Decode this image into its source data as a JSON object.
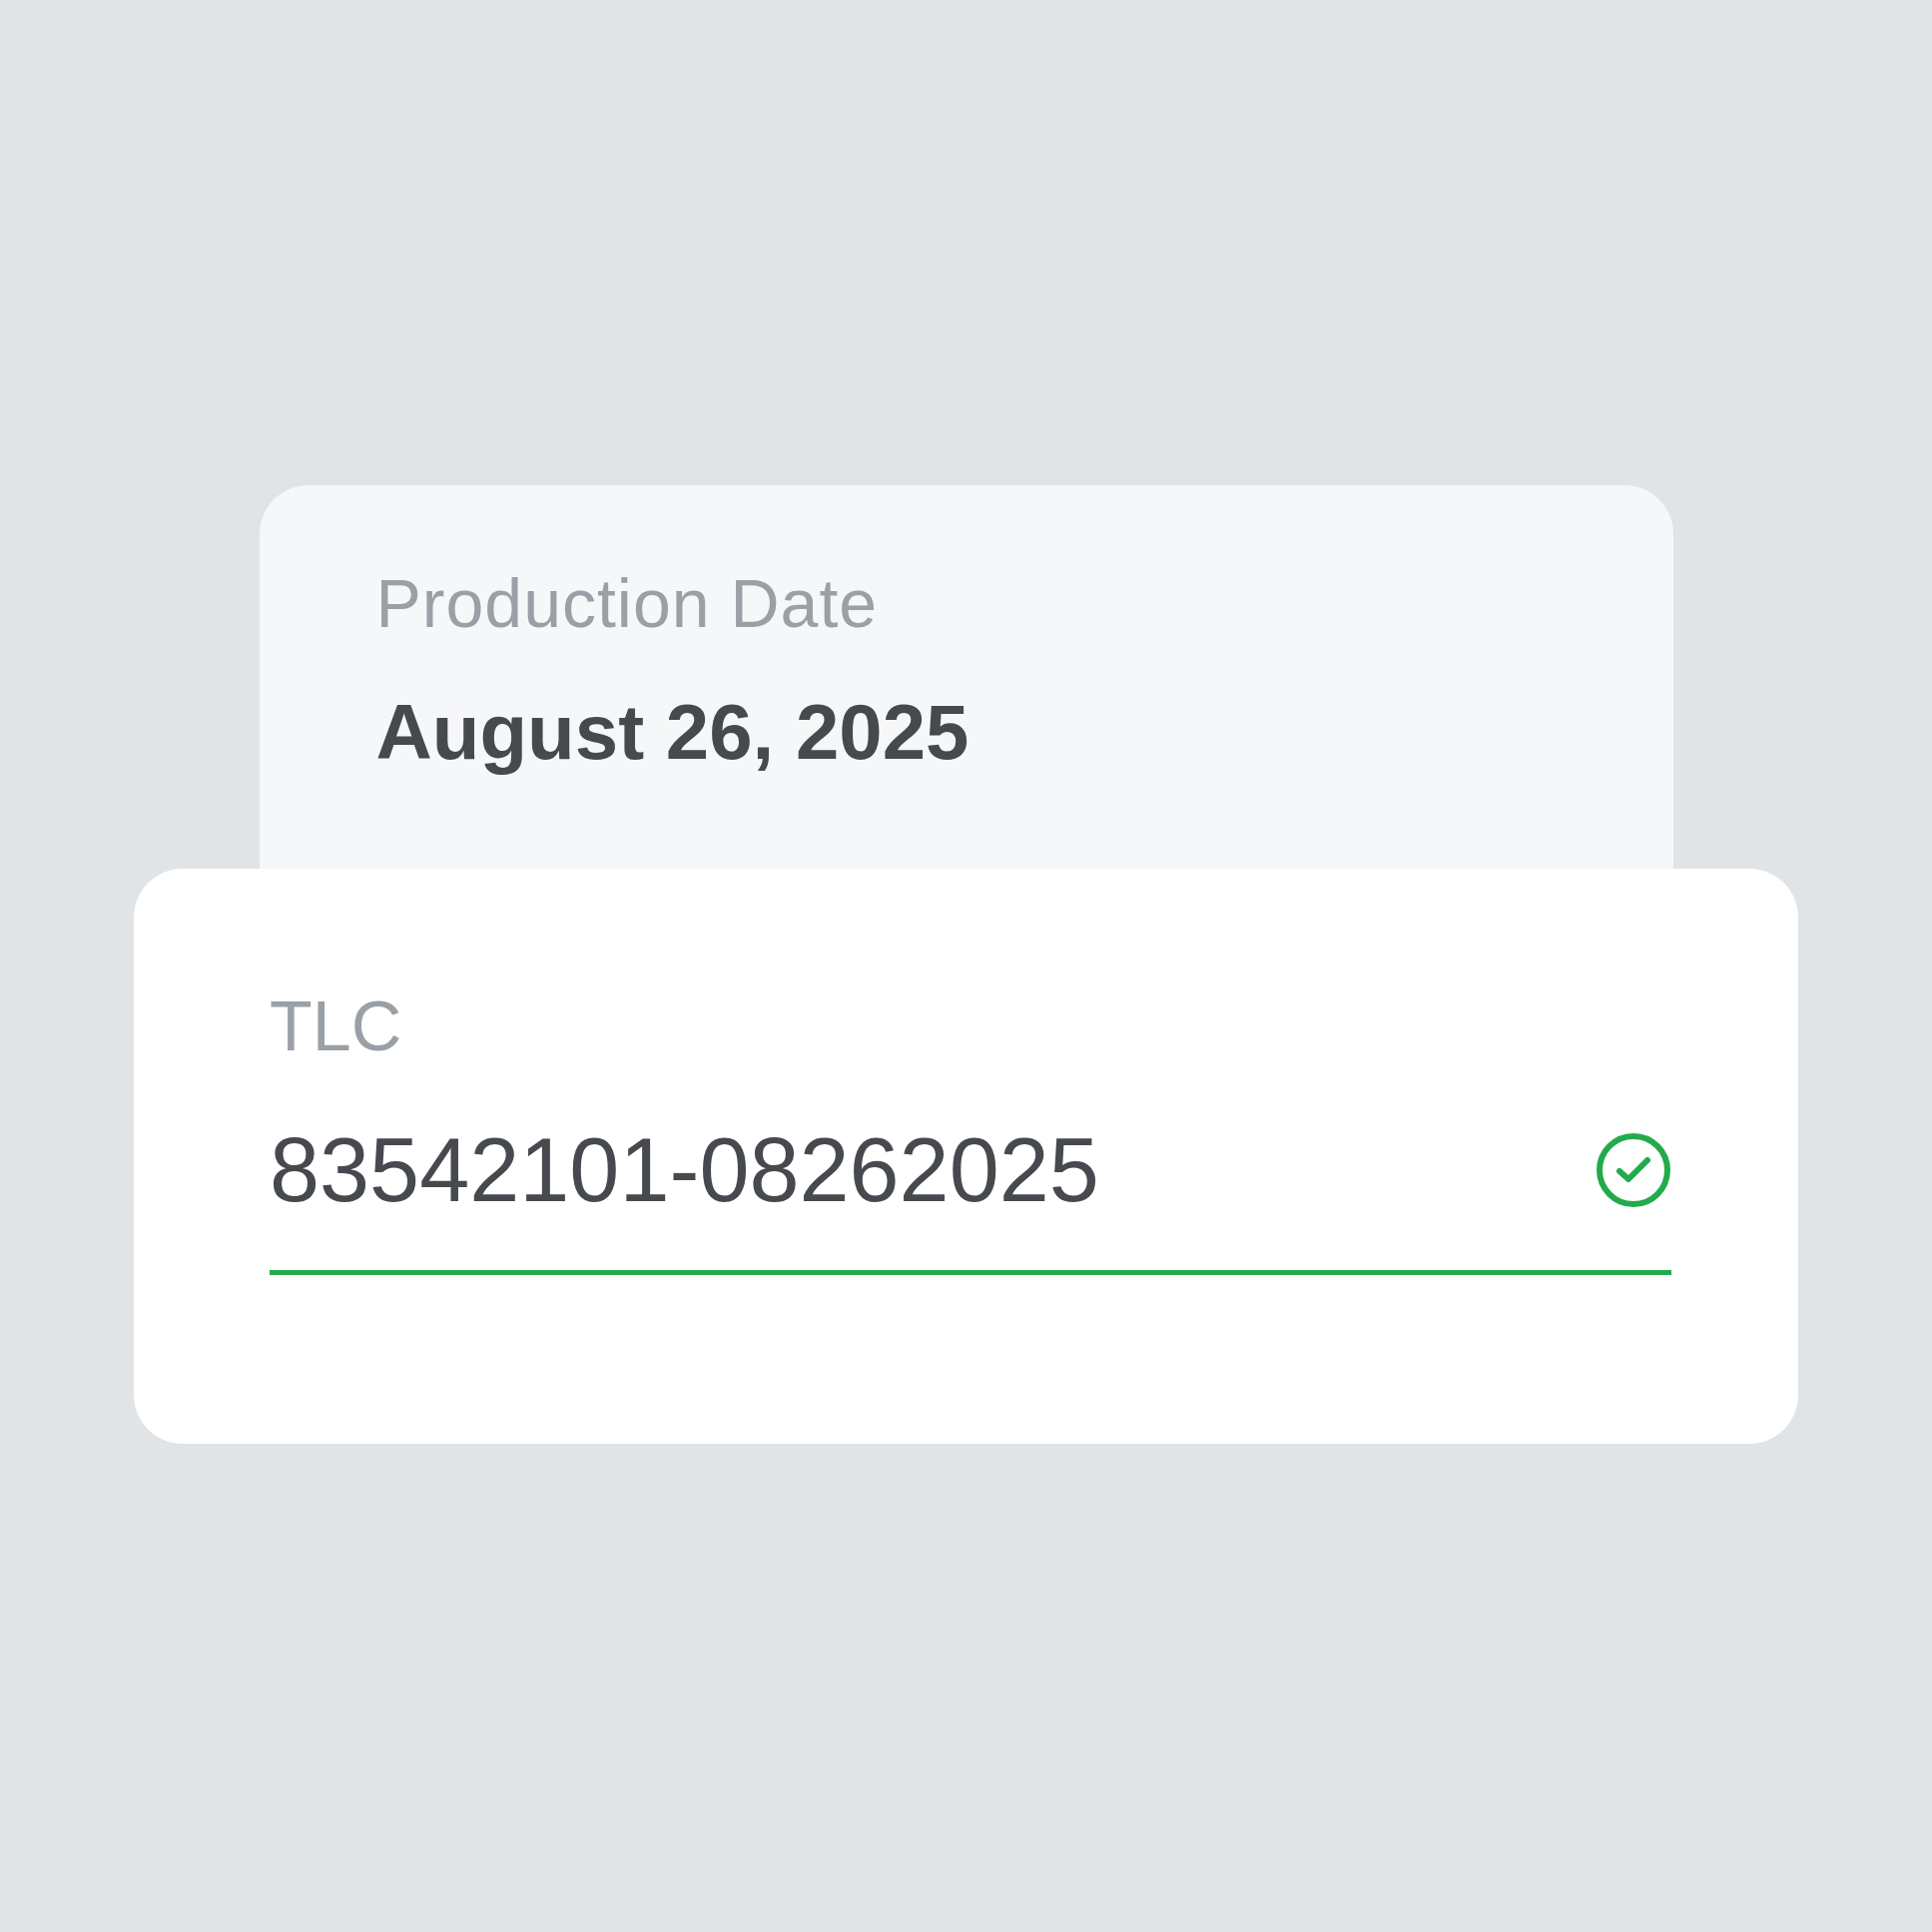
{
  "production_date": {
    "label": "Production Date",
    "value": "August 26, 2025"
  },
  "tlc_field": {
    "label": "TLC",
    "value": "83542101-08262025",
    "valid": true
  }
}
